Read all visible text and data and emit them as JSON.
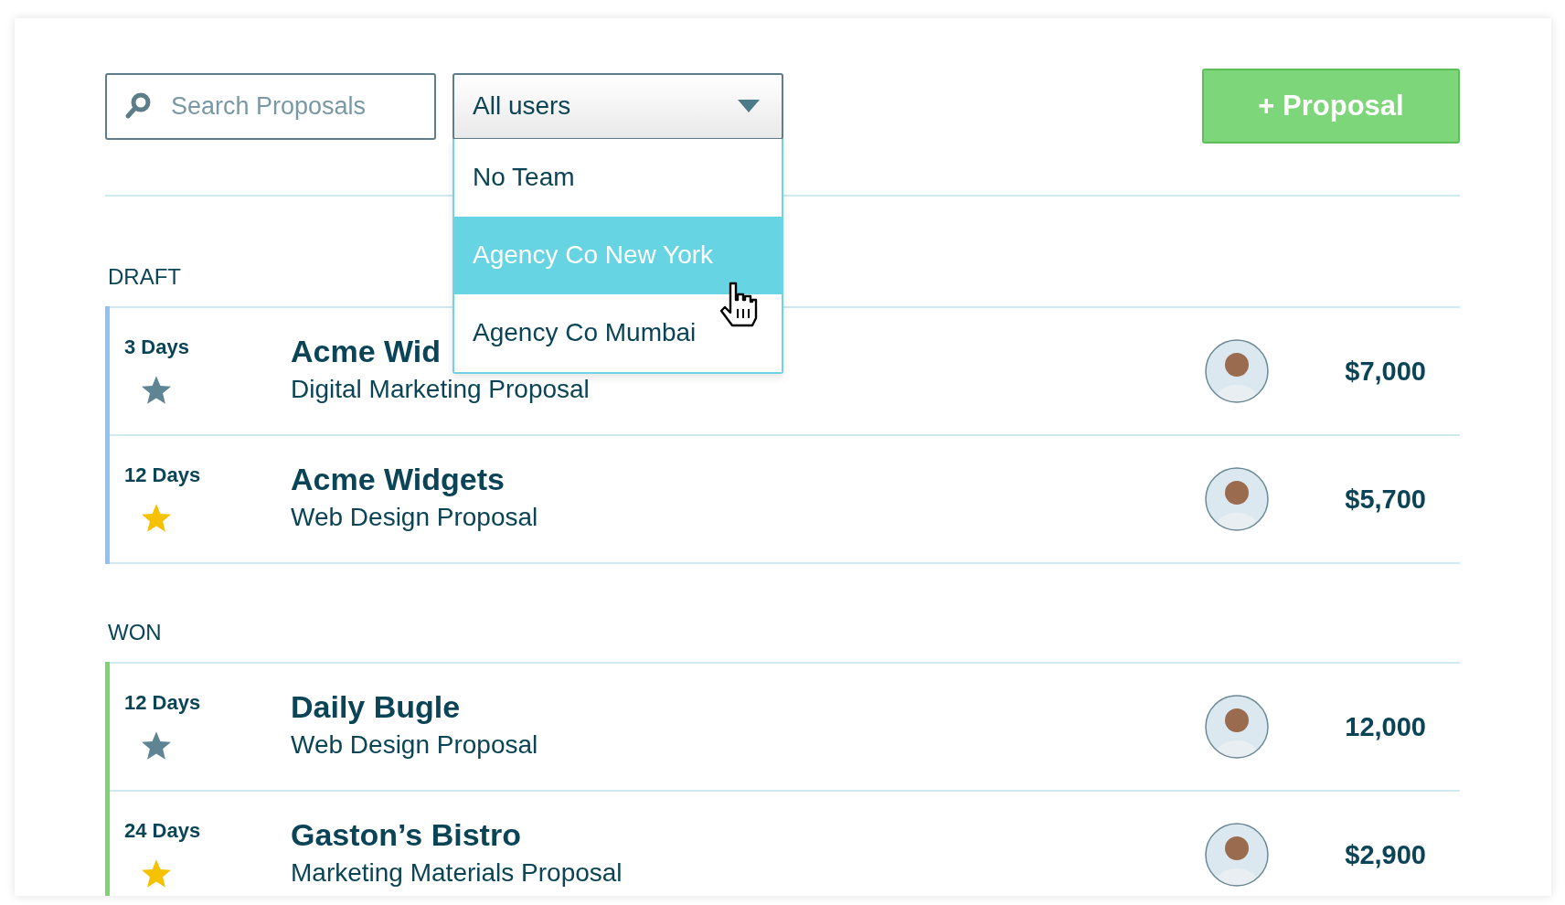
{
  "toolbar": {
    "search": {
      "placeholder": "Search Proposals"
    },
    "user_filter": {
      "value": "All users",
      "expanded": true,
      "options": [
        {
          "label": "No Team",
          "selected": false
        },
        {
          "label": "Agency Co New York",
          "selected": true
        },
        {
          "label": "Agency Co Mumbai",
          "selected": false
        }
      ]
    },
    "add_button": "+ Proposal"
  },
  "sections": [
    {
      "title": "DRAFT",
      "color": "#8ec1f5",
      "proposals": [
        {
          "days": "3 Days",
          "starred": false,
          "client": "Acme Wid",
          "type": "Digital Marketing Proposal",
          "amount": "$7,000"
        },
        {
          "days": "12 Days",
          "starred": true,
          "client": "Acme Widgets",
          "type": "Web Design Proposal",
          "amount": "$5,700"
        }
      ]
    },
    {
      "title": "WON",
      "color": "#7dd36f",
      "proposals": [
        {
          "days": "12 Days",
          "starred": false,
          "client": "Daily Bugle",
          "type": "Web Design Proposal",
          "amount": "12,000"
        },
        {
          "days": "24 Days",
          "starred": true,
          "client": "Gaston’s Bistro",
          "type": "Marketing Materials Proposal",
          "amount": "$2,900"
        }
      ]
    }
  ]
}
